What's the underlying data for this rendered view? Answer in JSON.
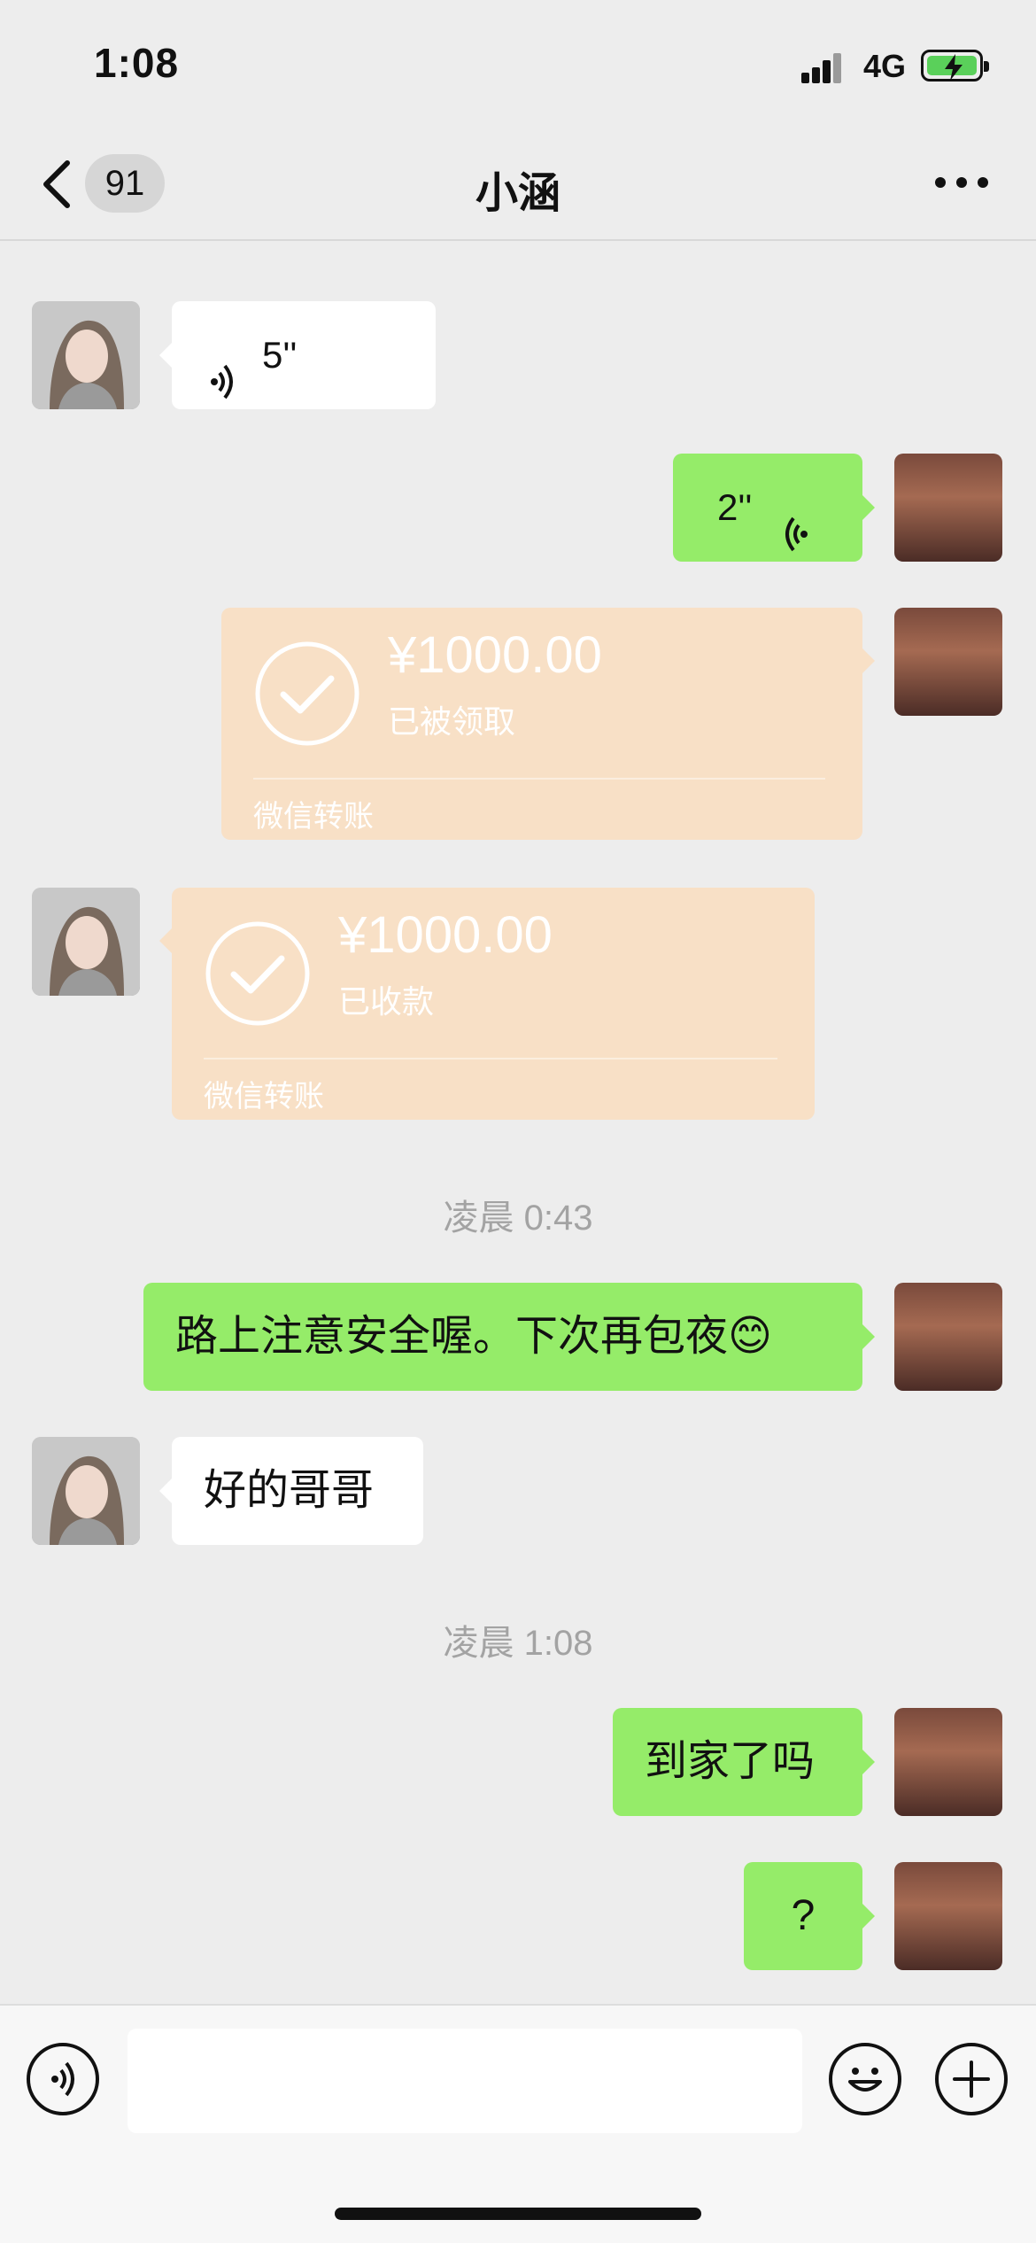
{
  "status_bar": {
    "time": "1:08",
    "network": "4G",
    "icons": [
      "signal-icon",
      "battery-charging-icon"
    ]
  },
  "nav": {
    "back_icon": "chevron-left-icon",
    "unread_count": "91",
    "title": "小涵",
    "more_icon": "ellipsis-icon"
  },
  "messages": {
    "voice_in": {
      "duration": "5''",
      "icon": "voice-wave-icon"
    },
    "voice_out": {
      "duration": "2''",
      "icon": "voice-wave-icon"
    },
    "transfer_out": {
      "amount": "¥1000.00",
      "status": "已被领取",
      "label": "微信转账",
      "icon": "check-circle-icon"
    },
    "transfer_in": {
      "amount": "¥1000.00",
      "status": "已收款",
      "label": "微信转账",
      "icon": "check-circle-icon"
    },
    "time_1": "凌晨 0:43",
    "text_out_1": "路上注意安全喔。下次再包夜😊",
    "text_in_1": "好的哥哥",
    "time_2": "凌晨 1:08",
    "text_out_2": "到家了吗",
    "text_out_3": "?"
  },
  "colors": {
    "background": "#EDEDED",
    "bubble_green": "#95EC69",
    "bubble_white": "#FFFFFF",
    "transfer_card": "#F8E0C6"
  },
  "input_bar": {
    "voice_icon": "voice-input-icon",
    "emoji_icon": "emoji-icon",
    "plus_icon": "plus-circle-icon",
    "placeholder": ""
  }
}
